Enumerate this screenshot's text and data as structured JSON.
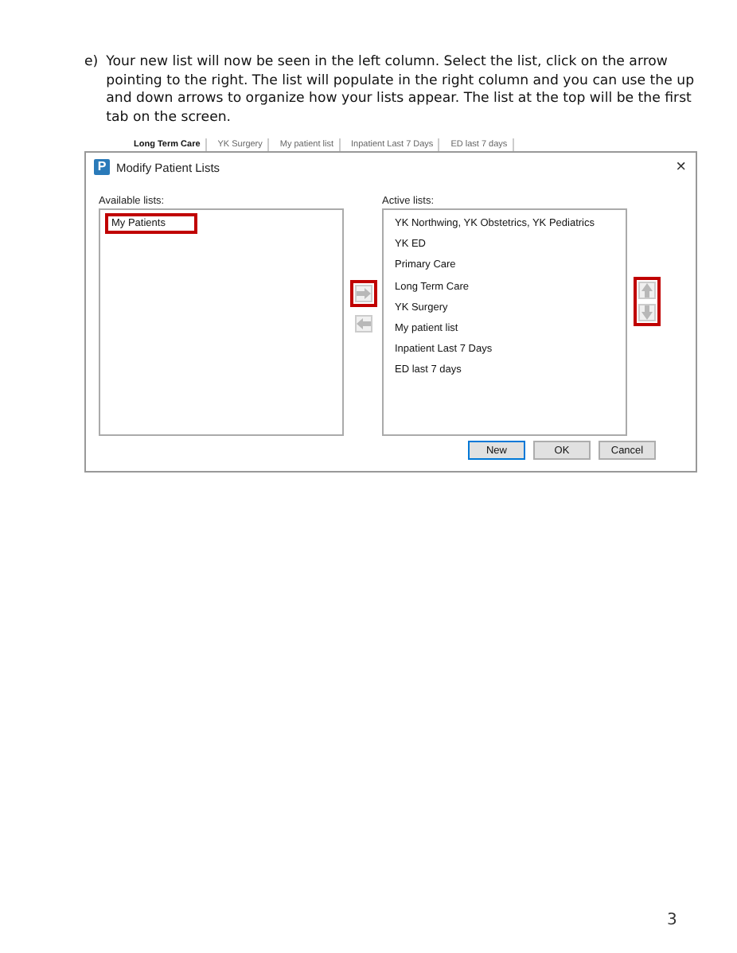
{
  "instruction": {
    "marker": "e)",
    "text": "Your new list will now be seen in the left column.  Select the list, click on the arrow pointing to the right.  The list will populate in the right column and you can use the up and down arrows to organize how your lists appear.  The list at the top will be the first tab on the screen."
  },
  "background_tabs": [
    {
      "label": "Long Term Care",
      "selected": true
    },
    {
      "label": "YK Surgery",
      "selected": false
    },
    {
      "label": "My patient list",
      "selected": false
    },
    {
      "label": "Inpatient Last 7 Days",
      "selected": false
    },
    {
      "label": "ED last 7 days",
      "selected": false
    }
  ],
  "dialog": {
    "app_icon": "P",
    "title": "Modify Patient Lists",
    "close": "×",
    "available": {
      "label": "Available lists:",
      "items": [
        {
          "name": "My Patients",
          "highlighted": true
        }
      ]
    },
    "move_buttons": [
      {
        "kind": "right",
        "highlighted": true
      },
      {
        "kind": "left",
        "highlighted": false
      }
    ],
    "active": {
      "label": "Active lists:",
      "items": [
        {
          "name": "YK Northwing, YK Obstetrics, YK Pediatrics",
          "highlighted": false
        },
        {
          "name": "YK ED",
          "highlighted": false
        },
        {
          "name": "Primary Care",
          "highlighted": false
        },
        {
          "name": "Long Term Care",
          "highlighted": false
        },
        {
          "name": "YK Surgery",
          "highlighted": false
        },
        {
          "name": "My patient list",
          "highlighted": false
        },
        {
          "name": "Inpatient Last 7 Days",
          "highlighted": false
        },
        {
          "name": "ED last 7 days",
          "highlighted": false
        }
      ]
    },
    "order_buttons": {
      "highlighted": true,
      "items": [
        {
          "kind": "up"
        },
        {
          "kind": "down"
        }
      ]
    },
    "buttons": [
      {
        "label": "New",
        "selected": true
      },
      {
        "label": "OK",
        "selected": false
      },
      {
        "label": "Cancel",
        "selected": false
      }
    ]
  },
  "page_number": "3"
}
